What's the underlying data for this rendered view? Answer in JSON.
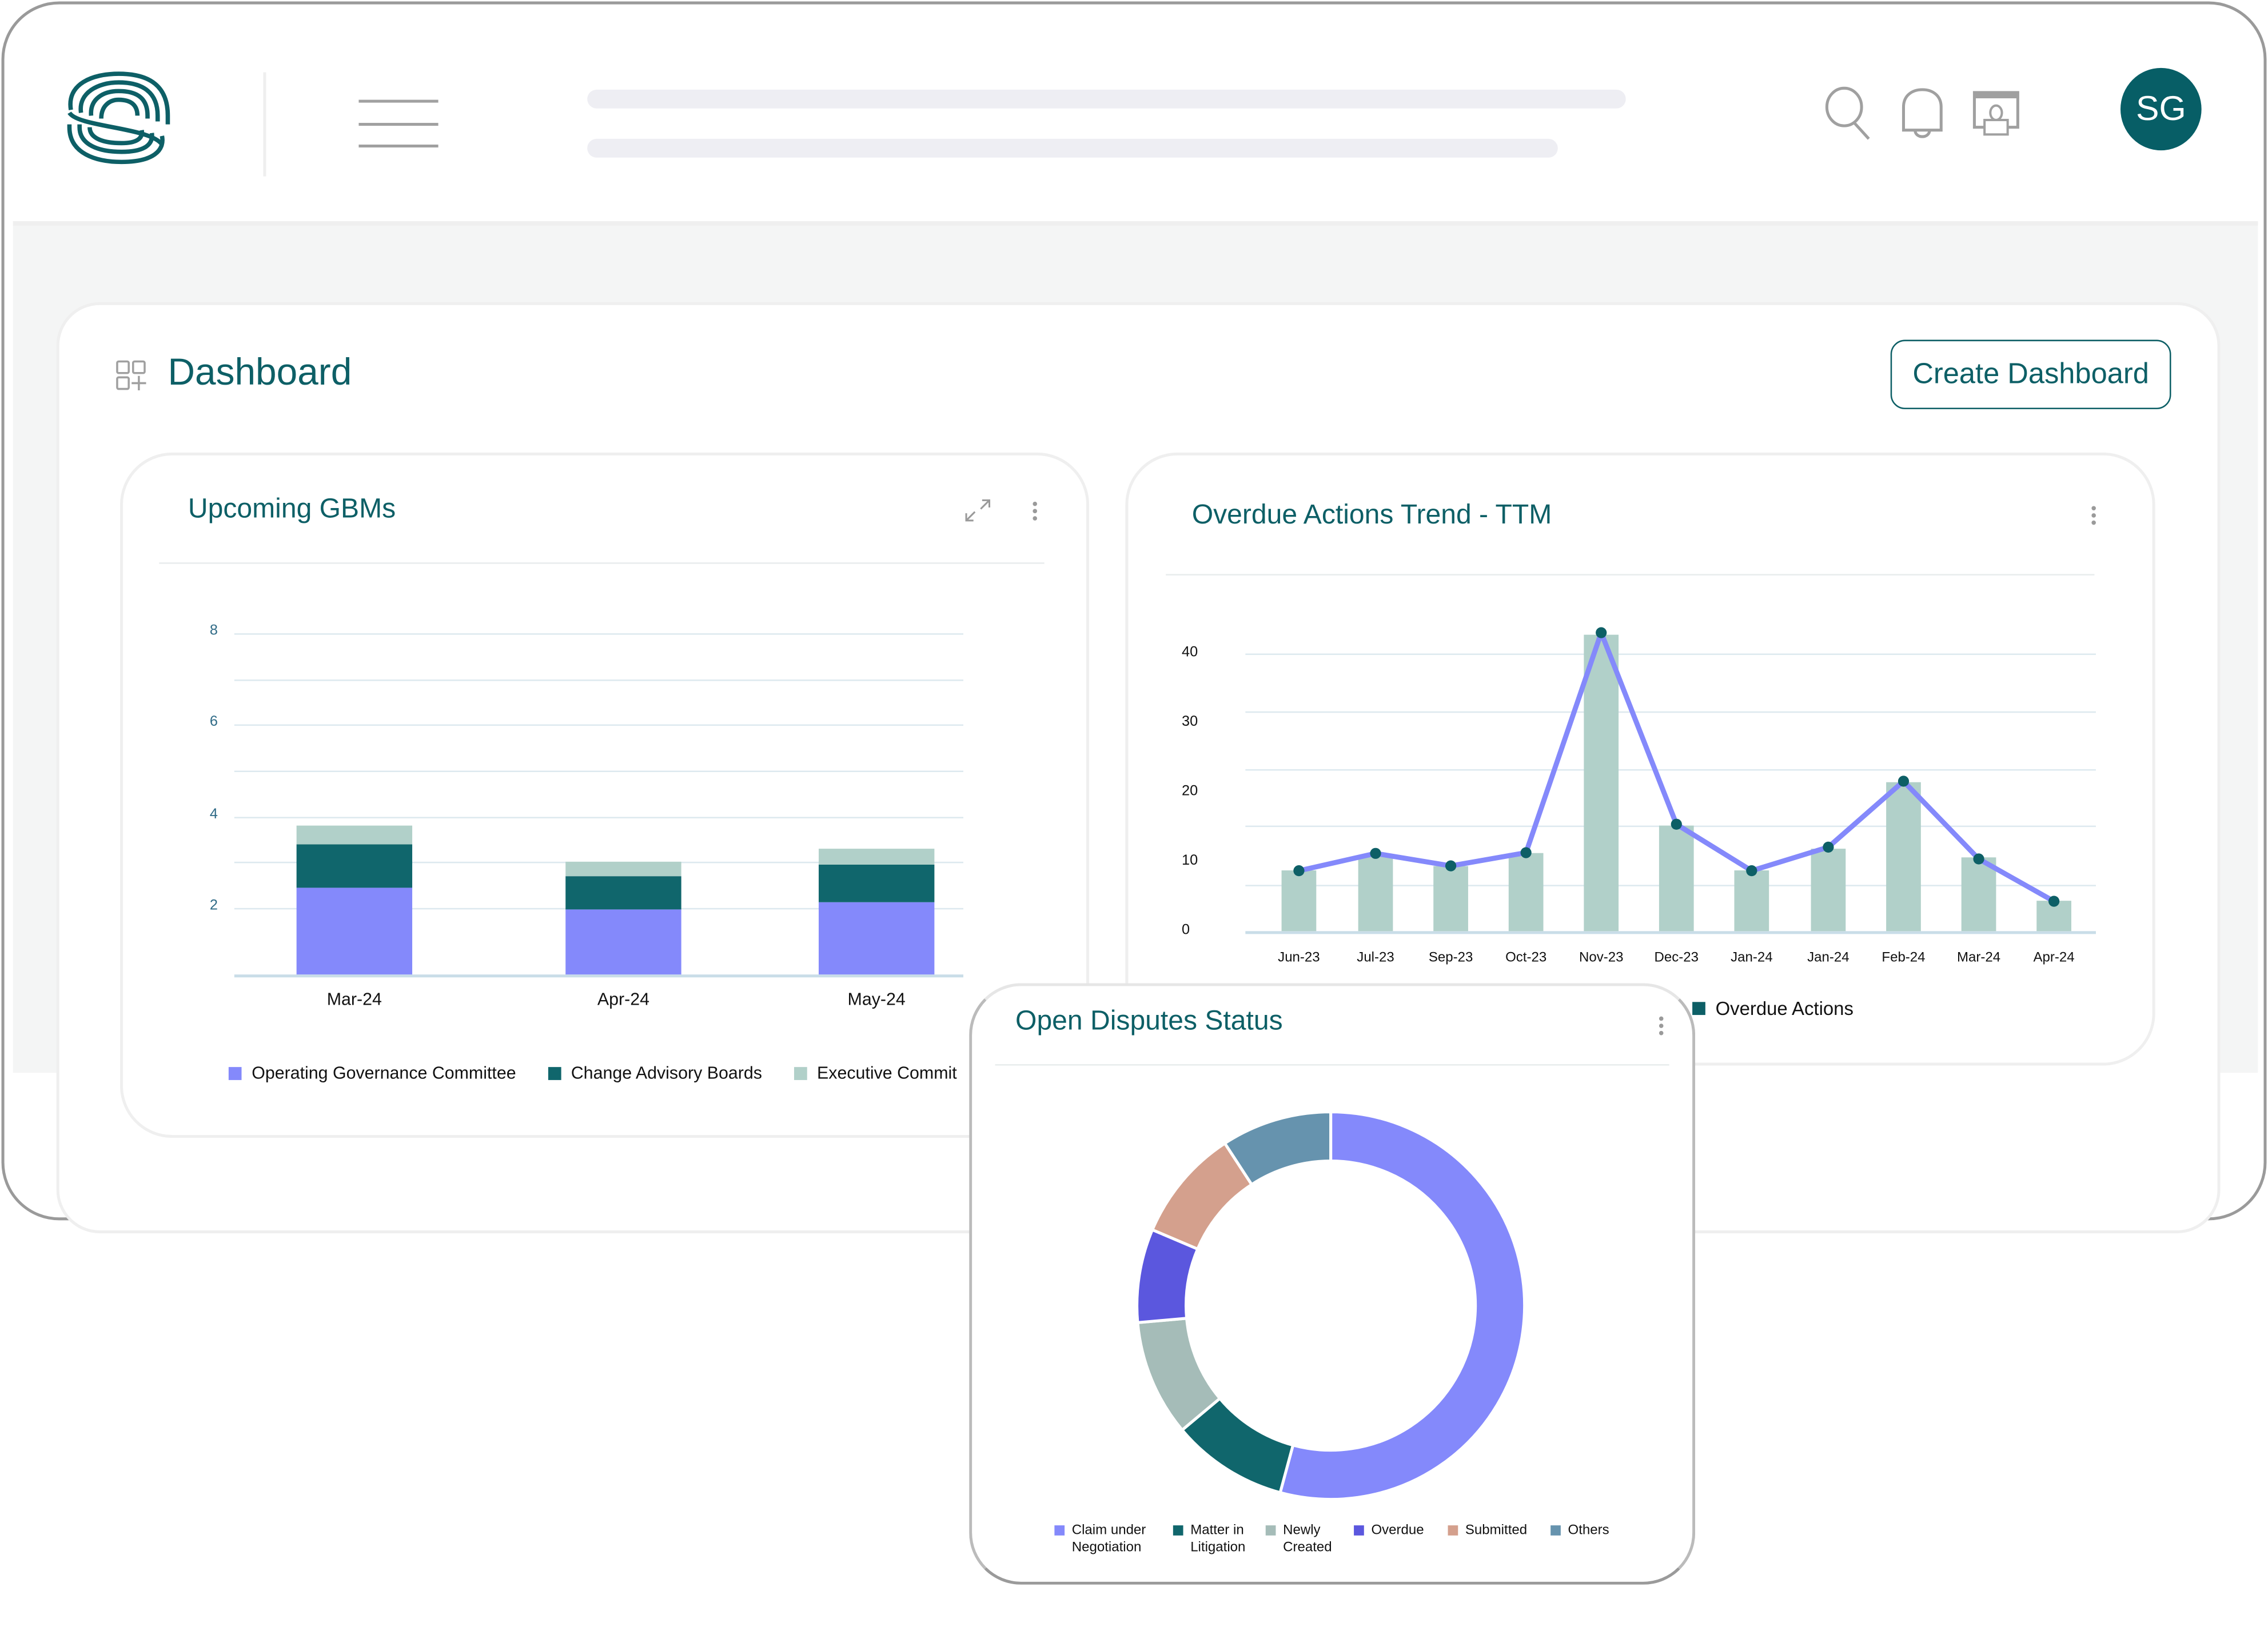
{
  "header": {
    "avatar_initials": "SG",
    "icons": [
      "logo",
      "menu-icon",
      "search-icon",
      "bell-icon",
      "presenter-icon"
    ]
  },
  "page": {
    "title": "Dashboard",
    "create_button": "Create Dashboard"
  },
  "colors": {
    "brand": "#0d5f66",
    "purple": "#8489fb",
    "teal": "#10666c",
    "sage": "#b1d0c9"
  },
  "chart_data": [
    {
      "type": "bar",
      "stacked": true,
      "title": "Upcoming GBMs",
      "categories": [
        "Mar-24",
        "Apr-24",
        "May-24"
      ],
      "yticks": [
        "2",
        "4",
        "6",
        "8"
      ],
      "ylim": [
        0.55,
        8
      ],
      "grid": true,
      "legend": "bottom",
      "series": [
        {
          "name": "Operating Governance Committee",
          "color": "#8489fb",
          "values": [
            1.89,
            1.41,
            1.58
          ]
        },
        {
          "name": "Change Advisory Boards",
          "color": "#10666c",
          "values": [
            0.95,
            0.72,
            0.81
          ]
        },
        {
          "name": "Executive Commit",
          "color": "#b1d0c9",
          "values": [
            0.42,
            0.32,
            0.35
          ]
        }
      ]
    },
    {
      "type": "bar+line",
      "title": "Overdue Actions Trend - TTM",
      "categories": [
        "Jun-23",
        "Jul-23",
        "Sep-23",
        "Oct-23",
        "Nov-23",
        "Dec-23",
        "Jan-24",
        "Jan-24",
        "Feb-24",
        "Mar-24",
        "Apr-24"
      ],
      "yticks": [
        "0",
        "10",
        "20",
        "30",
        "40"
      ],
      "ylim": [
        0,
        43
      ],
      "grid": true,
      "gridlines": [
        6.7,
        15.2,
        23.4,
        31.7,
        40
      ],
      "legend": "bottom",
      "series": [
        {
          "name": "Overdue Actions",
          "kind": "bar",
          "color": "#b1d0c9",
          "values": [
            8.7,
            10.8,
            9.3,
            11.2,
            42.8,
            15.2,
            8.7,
            11.9,
            21.4,
            10.7,
            4.3
          ]
        },
        {
          "kind": "line",
          "color": "#8489fb",
          "marker_color": "#0d5f66",
          "values": [
            8.7,
            11.2,
            9.4,
            11.3,
            43.0,
            15.4,
            8.7,
            12.1,
            21.6,
            10.4,
            4.3
          ]
        }
      ],
      "legend_swatch": "#0d5f66"
    },
    {
      "type": "pie",
      "donut": true,
      "title": "Open Disputes Status",
      "legend": "bottom",
      "slices": [
        {
          "label": "Claim under Negotiation",
          "line1": "Claim under",
          "line2": "Negotiation",
          "color": "#8489fb",
          "value": 54.2
        },
        {
          "label": "Matter in Litigation",
          "line1": "Matter in",
          "line2": "Litigation",
          "color": "#10666c",
          "value": 9.7
        },
        {
          "label": "Newly Created",
          "line1": "Newly",
          "line2": "Created",
          "color": "#a5bcb8",
          "value": 9.7
        },
        {
          "label": "Overdue",
          "line1": "Overdue",
          "line2": "",
          "color": "#5b57de",
          "value": 7.8
        },
        {
          "label": "Submitted",
          "line1": "Submitted",
          "line2": "",
          "color": "#d4a08d",
          "value": 9.4
        },
        {
          "label": "Others",
          "line1": "Others",
          "line2": "",
          "color": "#6693ae",
          "value": 9.2
        }
      ]
    }
  ]
}
